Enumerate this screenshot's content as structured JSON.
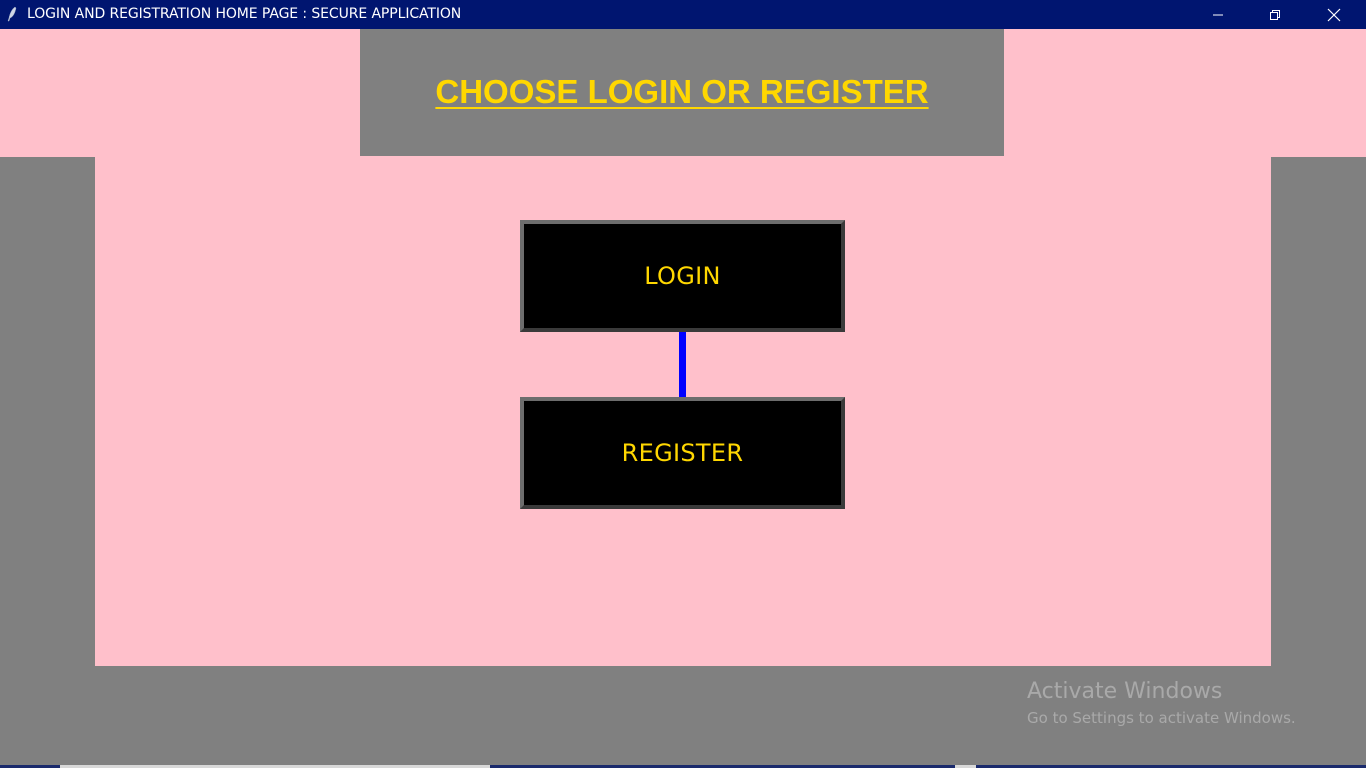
{
  "window": {
    "title": "LOGIN AND REGISTRATION HOME PAGE : SECURE APPLICATION",
    "icon": "feather-icon",
    "controls": [
      "minimize-icon",
      "maximize-icon",
      "close-icon"
    ]
  },
  "header": {
    "title": "CHOOSE LOGIN OR REGISTER"
  },
  "buttons": {
    "login_label": "LOGIN",
    "register_label": "REGISTER"
  },
  "watermark": {
    "title": "Activate Windows",
    "subtitle": "Go to Settings to activate Windows."
  },
  "colors": {
    "titlebar": "#001570",
    "background_gray": "#808080",
    "panel_pink": "#ffc0cb",
    "button_bg": "#000000",
    "button_text": "#ffd700",
    "header_text": "#ffd700",
    "connector": "#0000ff"
  }
}
